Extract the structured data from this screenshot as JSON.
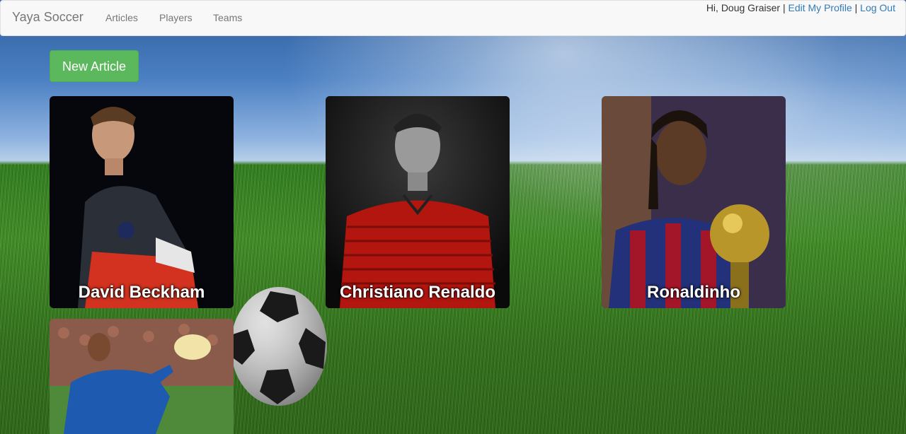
{
  "navbar": {
    "brand": "Yaya Soccer",
    "links": [
      "Articles",
      "Players",
      "Teams"
    ],
    "greeting": "Hi, Doug Graiser",
    "separator": " | ",
    "edit_profile": "Edit My Profile",
    "logout": "Log Out"
  },
  "actions": {
    "new_article": "New Article"
  },
  "players": [
    {
      "name": "David Beckham"
    },
    {
      "name": "Christiano Renaldo"
    },
    {
      "name": "Ronaldinho"
    },
    {
      "name": ""
    }
  ],
  "colors": {
    "primary_button": "#5cb85c",
    "link": "#337ab7",
    "navbar_bg": "#f8f8f8"
  }
}
